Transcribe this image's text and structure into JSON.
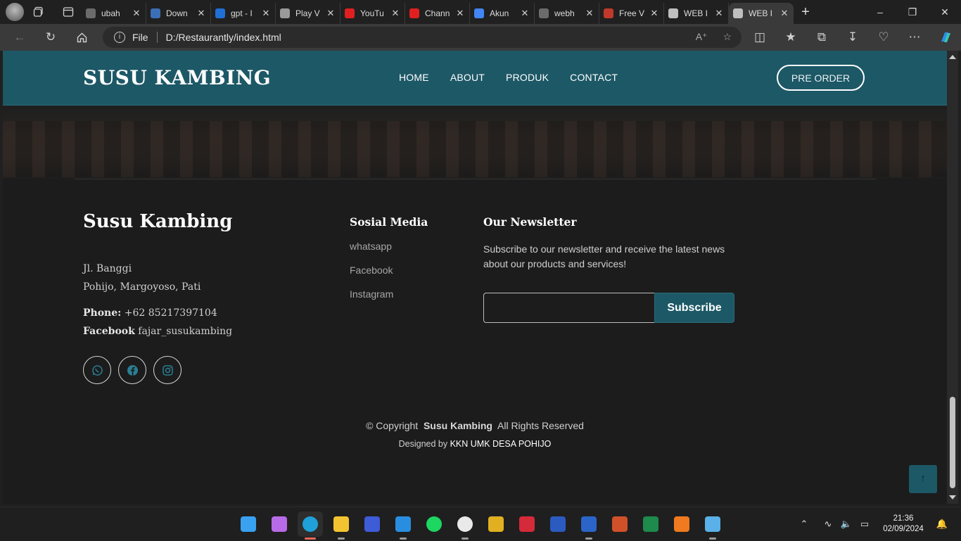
{
  "browser": {
    "tabs": [
      {
        "title": "ubah",
        "color": "#6b6b6b"
      },
      {
        "title": "Down",
        "color": "#3b6fb6"
      },
      {
        "title": "gpt - I",
        "color": "#1f6fd6"
      },
      {
        "title": "Play V",
        "color": "#9a9a9a"
      },
      {
        "title": "YouTu",
        "color": "#e02020"
      },
      {
        "title": "Chann",
        "color": "#e02020"
      },
      {
        "title": "Akun",
        "color": "#4285f4"
      },
      {
        "title": "webh",
        "color": "#6b6b6b"
      },
      {
        "title": "Free V",
        "color": "#c0392b"
      },
      {
        "title": "WEB I",
        "color": "#bfbfbf"
      },
      {
        "title": "WEB I",
        "color": "#bfbfbf",
        "active": true
      }
    ],
    "address": {
      "scheme_label": "File",
      "url": "D:/Restaurantly/index.html"
    }
  },
  "site": {
    "brand": "SUSU KAMBING",
    "menu": [
      "HOME",
      "ABOUT",
      "PRODUK",
      "CONTACT"
    ],
    "cta": "PRE ORDER"
  },
  "footer": {
    "brand": "Susu Kambing",
    "address_line1": "Jl. Banggi",
    "address_line2": "Pohijo, Margoyoso, Pati",
    "phone_label": "Phone:",
    "phone": "+62 85217397104",
    "facebook_label": "Facebook",
    "facebook": "fajar_susukambing",
    "social_heading": "Sosial Media",
    "social_links": [
      "whatsapp",
      "Facebook",
      "Instagram"
    ],
    "newsletter_heading": "Our Newsletter",
    "newsletter_text": "Subscribe to our newsletter and receive the latest news about our products and services!",
    "subscribe_label": "Subscribe",
    "copyright_prefix": "© Copyright",
    "copyright_brand": "Susu Kambing",
    "copyright_suffix": "All Rights Reserved",
    "designed_prefix": "Designed by",
    "designed_by": "KKN UMK DESA POHIJO"
  },
  "taskbar": {
    "time": "21:36",
    "date": "02/09/2024",
    "apps": [
      {
        "name": "start",
        "color": "#3aa0f0"
      },
      {
        "name": "copilot",
        "color": "#b86be8"
      },
      {
        "name": "edge",
        "color": "#1fa0d8",
        "active": true
      },
      {
        "name": "file-explorer",
        "color": "#f2c431"
      },
      {
        "name": "app-blue",
        "color": "#3e5bd8"
      },
      {
        "name": "vscode",
        "color": "#2a8ee0"
      },
      {
        "name": "spotify",
        "color": "#1ed760"
      },
      {
        "name": "media-player",
        "color": "#e9e9e9"
      },
      {
        "name": "tool-app",
        "color": "#e0b020"
      },
      {
        "name": "app-red",
        "color": "#d42a3a"
      },
      {
        "name": "app-visio",
        "color": "#2b5bc0"
      },
      {
        "name": "word",
        "color": "#2b65c9"
      },
      {
        "name": "powerpoint",
        "color": "#d0502a"
      },
      {
        "name": "excel",
        "color": "#1e8a4c"
      },
      {
        "name": "xampp",
        "color": "#f07a1f"
      },
      {
        "name": "notepad",
        "color": "#5ab0e8"
      }
    ]
  },
  "colors": {
    "header_teal": "#1d5866",
    "page_bg": "#1c1c1c"
  }
}
